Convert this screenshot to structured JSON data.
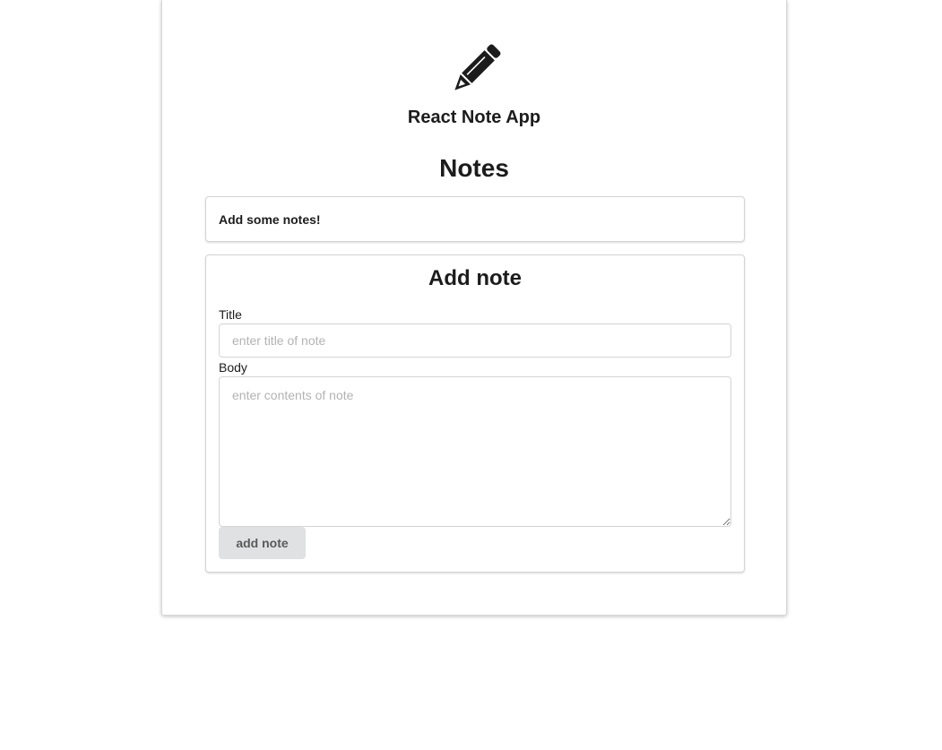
{
  "header": {
    "logo_icon": "pencil-icon",
    "app_title": "React Note App"
  },
  "notes": {
    "section_title": "Notes",
    "empty_message": "Add some notes!"
  },
  "add_note_form": {
    "title": "Add note",
    "title_label": "Title",
    "title_placeholder": "enter title of note",
    "title_value": "",
    "body_label": "Body",
    "body_placeholder": "enter contents of note",
    "body_value": "",
    "submit_label": "add note"
  },
  "colors": {
    "text": "#1c1c1c",
    "button_bg": "#e0e1e2",
    "button_text": "#5a5a5a",
    "border": "#d4d4d5"
  }
}
